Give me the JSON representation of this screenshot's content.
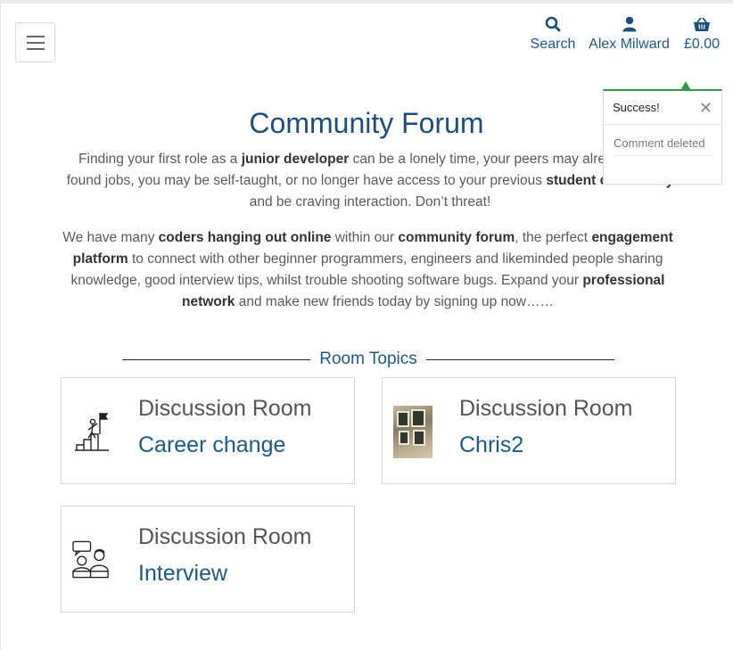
{
  "header": {
    "search_label": "Search",
    "account_label": "Alex Milward",
    "basket_label": "£0.00"
  },
  "toast": {
    "title": "Success!",
    "message": "Comment deleted",
    "color": "#2e9b46"
  },
  "main": {
    "title": "Community Forum",
    "intro": [
      {
        "t": "Finding your first role as a ",
        "b": false
      },
      {
        "t": "junior developer",
        "b": true
      },
      {
        "t": " can be a lonely time, your peers may already have found jobs, you may be self-taught, or no longer have access to your previous ",
        "b": false
      },
      {
        "t": "student community",
        "b": true
      },
      {
        "t": " and be craving interaction. Don’t threat!",
        "b": false
      }
    ],
    "body": [
      {
        "t": "We have many ",
        "b": false
      },
      {
        "t": "coders hanging out online",
        "b": true
      },
      {
        "t": " within our ",
        "b": false
      },
      {
        "t": "community forum",
        "b": true
      },
      {
        "t": ", the perfect ",
        "b": false
      },
      {
        "t": "engagement platform",
        "b": true
      },
      {
        "t": " to connect with other beginner programmers, engineers and likeminded people sharing knowledge, good interview tips, whilst trouble shooting software bugs. Expand your ",
        "b": false
      },
      {
        "t": "professional network",
        "b": true
      },
      {
        "t": " and make new friends today by signing up now……",
        "b": false
      }
    ],
    "topics_heading": "Room Topics"
  },
  "rooms": [
    {
      "heading": "Discussion Room",
      "topic": "Career change",
      "icon": "career-stairs-icon"
    },
    {
      "heading": "Discussion Room",
      "topic": "Chris2",
      "icon": "room-photo"
    },
    {
      "heading": "Discussion Room",
      "topic": "Interview",
      "icon": "interview-people-icon"
    }
  ],
  "colors": {
    "accent": "#1b5a8a",
    "title": "#1b4f80"
  }
}
